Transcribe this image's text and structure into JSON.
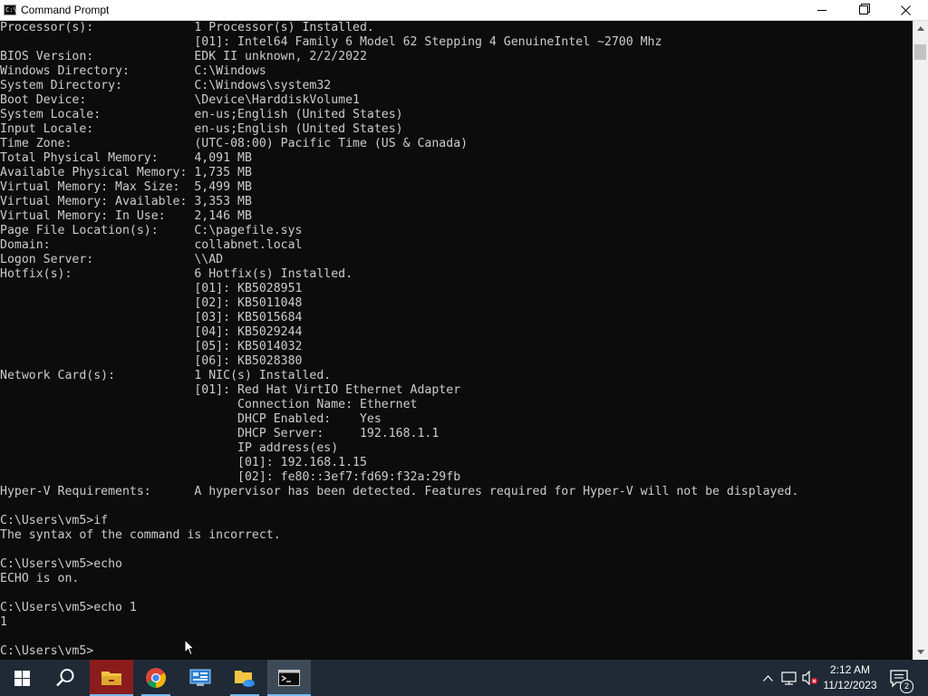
{
  "window": {
    "title": "Command Prompt",
    "icon": "cmd-app-icon",
    "controls": [
      "minimize-icon",
      "maximize-icon",
      "close-icon"
    ]
  },
  "console": {
    "lines": [
      "Processor(s):              1 Processor(s) Installed.",
      "                           [01]: Intel64 Family 6 Model 62 Stepping 4 GenuineIntel ~2700 Mhz",
      "BIOS Version:              EDK II unknown, 2/2/2022",
      "Windows Directory:         C:\\Windows",
      "System Directory:          C:\\Windows\\system32",
      "Boot Device:               \\Device\\HarddiskVolume1",
      "System Locale:             en-us;English (United States)",
      "Input Locale:              en-us;English (United States)",
      "Time Zone:                 (UTC-08:00) Pacific Time (US & Canada)",
      "Total Physical Memory:     4,091 MB",
      "Available Physical Memory: 1,735 MB",
      "Virtual Memory: Max Size:  5,499 MB",
      "Virtual Memory: Available: 3,353 MB",
      "Virtual Memory: In Use:    2,146 MB",
      "Page File Location(s):     C:\\pagefile.sys",
      "Domain:                    collabnet.local",
      "Logon Server:              \\\\AD",
      "Hotfix(s):                 6 Hotfix(s) Installed.",
      "                           [01]: KB5028951",
      "                           [02]: KB5011048",
      "                           [03]: KB5015684",
      "                           [04]: KB5029244",
      "                           [05]: KB5014032",
      "                           [06]: KB5028380",
      "Network Card(s):           1 NIC(s) Installed.",
      "                           [01]: Red Hat VirtIO Ethernet Adapter",
      "                                 Connection Name: Ethernet",
      "                                 DHCP Enabled:    Yes",
      "                                 DHCP Server:     192.168.1.1",
      "                                 IP address(es)",
      "                                 [01]: 192.168.1.15",
      "                                 [02]: fe80::3ef7:fd69:f32a:29fb",
      "Hyper-V Requirements:      A hypervisor has been detected. Features required for Hyper-V will not be displayed.",
      "",
      "C:\\Users\\vm5>if",
      "The syntax of the command is incorrect.",
      "",
      "C:\\Users\\vm5>echo",
      "ECHO is on.",
      "",
      "C:\\Users\\vm5>echo 1",
      "1",
      "",
      "C:\\Users\\vm5>"
    ]
  },
  "taskbar": {
    "apps": [
      {
        "name": "start-button",
        "icon": "windows-logo-icon"
      },
      {
        "name": "search-button",
        "icon": "search-icon"
      },
      {
        "name": "file-explorer-button",
        "icon": "folder-icon"
      },
      {
        "name": "chrome-button",
        "icon": "chrome-icon"
      },
      {
        "name": "control-panel-button",
        "icon": "control-panel-icon"
      },
      {
        "name": "onedrive-folder-button",
        "icon": "folder-cloud-icon"
      },
      {
        "name": "command-prompt-button",
        "icon": "cmd-icon"
      }
    ],
    "clock": {
      "time": "2:12 AM",
      "date": "11/12/2023"
    },
    "notification_count": "2",
    "colors": {
      "taskbar": "#1f2a36",
      "active_app": "#3c4a58",
      "accent": "#76b9ed"
    }
  }
}
